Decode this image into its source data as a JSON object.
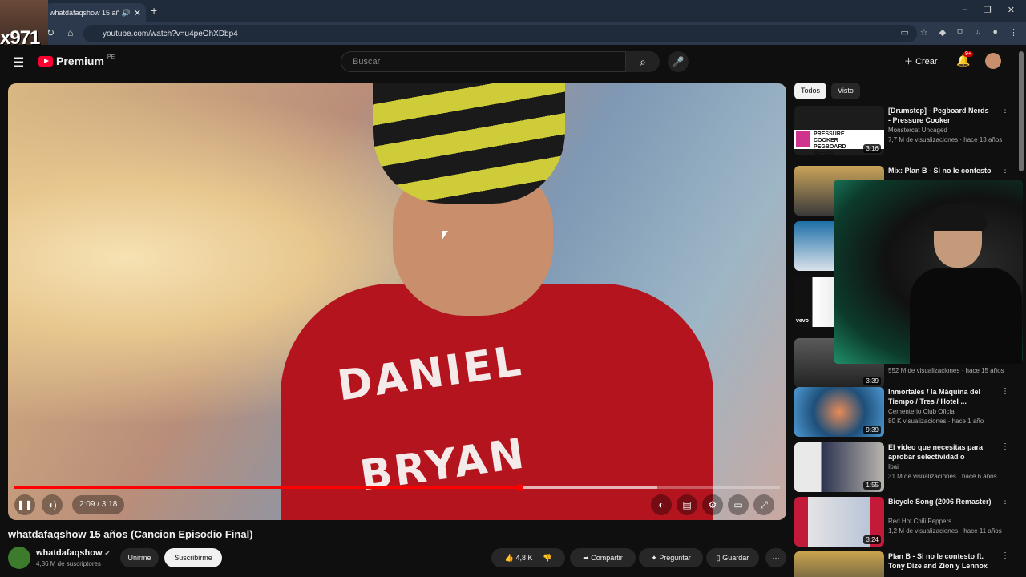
{
  "browser": {
    "tab_title": "whatdafaqshow 15 añ",
    "new_tab_icon": "+",
    "url": "youtube.com/watch?v=u4peOhXDbp4"
  },
  "overlay": {
    "stream_label": "x971"
  },
  "header": {
    "logo_text": "Premium",
    "region": "PE",
    "search_placeholder": "Buscar",
    "create_label": "Crear",
    "notifications_badge": "9+"
  },
  "player": {
    "shirt_line1": "DANIEL",
    "shirt_line2": "BRYAN",
    "current_time": "2:09",
    "duration": "3:18",
    "time_display": "2:09 / 3:18",
    "progress": 0.66,
    "buffered": 0.84
  },
  "video": {
    "title": "whatdafaqshow 15 años (Cancion Episodio Final)",
    "channel": "whatdafaqshow",
    "subscribers": "4,86 M de suscriptores",
    "join_label": "Unirme",
    "subscribe_label": "Suscribirme",
    "likes": "4,8 K",
    "share_label": "Compartir",
    "ask_label": "Preguntar",
    "save_label": "Guardar"
  },
  "sidebar": {
    "chips": [
      "Todos",
      "Visto"
    ],
    "items": [
      {
        "title": "[Drumstep] - Pegboard Nerds - Pressure Cooker [Monstercat ...",
        "channel": "Monstercat Uncaged",
        "meta": "7,7 M de visualizaciones · hace 13 años",
        "duration": "3:16",
        "thumb_text": "PRESSURE COOKER PEGBOARD NERDS"
      },
      {
        "title": "Mix: Plan B - Si no le contesto",
        "channel": "",
        "meta": "",
        "duration": ""
      },
      {
        "title": "",
        "channel": "",
        "meta": "",
        "duration": ""
      },
      {
        "title": "",
        "channel": "",
        "meta": "",
        "duration": "",
        "thumb_text": "vevo"
      },
      {
        "title": "",
        "channel": "",
        "meta": "552 M de visualizaciones · hace 15 años",
        "duration": "3:39"
      },
      {
        "title": "Inmortales / la Máquina del Tiempo / Tres / Hotel ...",
        "channel": "Cementerio Club Oficial",
        "meta": "80 K visualizaciones · hace 1 año",
        "duration": "9:39"
      },
      {
        "title": "El video que necesitas para aprobar selectividad o cualqui...",
        "channel": "Ibai",
        "meta": "31 M de visualizaciones · hace 6 años",
        "duration": "1:55"
      },
      {
        "title": "Bicycle Song (2006 Remaster)",
        "channel": "Red Hot Chili Peppers",
        "meta": "1,2 M de visualizaciones · hace 11 años",
        "duration": "3:24"
      },
      {
        "title": "Plan B - Si no le contesto ft. Tony Dize and Zion y Lennox ...",
        "channel": "",
        "meta": "",
        "duration": ""
      }
    ]
  },
  "colors": {
    "accent": "#ff0000",
    "background": "#0f0f0f"
  }
}
